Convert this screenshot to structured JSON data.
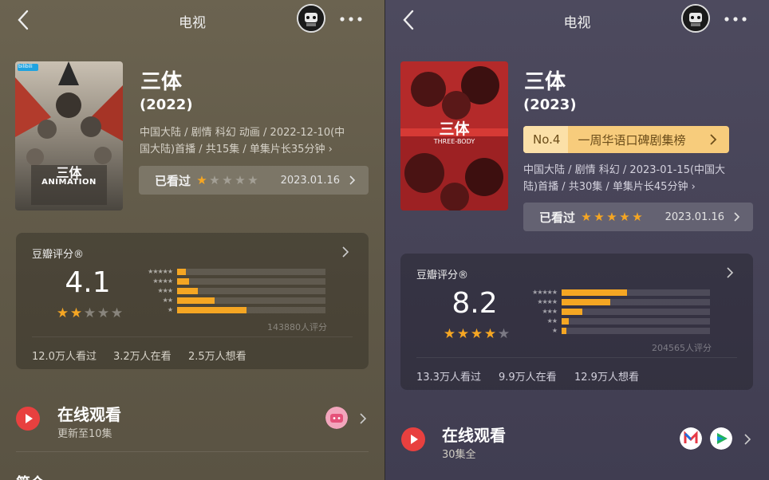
{
  "left": {
    "header_title": "电视",
    "title": "三体",
    "year": "(2022)",
    "meta": [
      "中国大陆 / 剧情 科幻 动画 / 2022-12-10(中",
      "国大陆)首播 / 共15集 / 单集片长35分钟 ›"
    ],
    "poster": {
      "badge": "bilibili",
      "title_cn": "三体",
      "title_en": "ANIMATION"
    },
    "watched": {
      "label": "已看过",
      "stars": 1,
      "date": "2023.01.16"
    },
    "rating": {
      "header": "豆瓣评分®",
      "score": "4.1",
      "stars": 2,
      "distribution": [
        {
          "stars": "★★★★★",
          "fraction": 0.06
        },
        {
          "stars": "★★★★",
          "fraction": 0.08
        },
        {
          "stars": "★★★",
          "fraction": 0.14
        },
        {
          "stars": "★★",
          "fraction": 0.25
        },
        {
          "stars": "★",
          "fraction": 0.47
        }
      ],
      "count": "143880人评分",
      "stats": [
        "12.0万人看过",
        "3.2万人在看",
        "2.5万人想看"
      ]
    },
    "watch": {
      "title": "在线观看",
      "sub": "更新至10集",
      "provider": "bilibili"
    },
    "peek": "简介"
  },
  "right": {
    "header_title": "电视",
    "title": "三体",
    "year": "(2023)",
    "rank": {
      "no": "No.4",
      "name": "一周华语口碑剧集榜"
    },
    "meta": [
      "中国大陆 / 剧情 科幻 / 2023-01-15(中国大",
      "陆)首播 / 共30集 / 单集片长45分钟 ›"
    ],
    "poster": {
      "title_cn": "三体",
      "title_en": "THREE-BODY"
    },
    "watched": {
      "label": "已看过",
      "stars": 5,
      "date": "2023.01.16"
    },
    "rating": {
      "header": "豆瓣评分®",
      "score": "8.2",
      "stars": 4,
      "distribution": [
        {
          "stars": "★★★★★",
          "fraction": 0.44
        },
        {
          "stars": "★★★★",
          "fraction": 0.33
        },
        {
          "stars": "★★★",
          "fraction": 0.14
        },
        {
          "stars": "★★",
          "fraction": 0.05
        },
        {
          "stars": "★",
          "fraction": 0.03
        }
      ],
      "count": "204565人评分",
      "stats": [
        "13.3万人看过",
        "9.9万人在看",
        "12.9万人想看"
      ]
    },
    "watch": {
      "title": "在线观看",
      "sub": "30集全",
      "providers": [
        "migu",
        "tencent-video"
      ]
    }
  },
  "colors": {
    "star": "#f5a623",
    "play": "#e8403f",
    "rank_bg": "#f7cc7c"
  }
}
